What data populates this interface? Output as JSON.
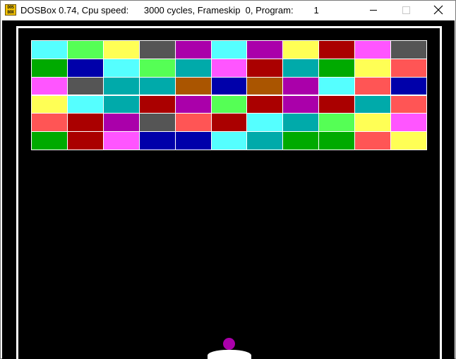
{
  "window": {
    "title": "DOSBox 0.74, Cpu speed:      3000 cycles, Frameskip  0, Program:        1",
    "icon_text": "DOS BOX",
    "icon_name": "dosbox-app-icon",
    "buttons": {
      "minimize": "minimize-icon",
      "maximize": "maximize-icon",
      "close": "close-icon"
    }
  },
  "game": {
    "background": "#000000",
    "wall_color": "#ffffff",
    "paddle_color": "#ffffff",
    "ball_color": "#aa00aa",
    "palette": {
      "LC": "#55ffff",
      "LG": "#55ff55",
      "Y": "#ffff55",
      "DG": "#555555",
      "M": "#aa00aa",
      "R": "#aa0000",
      "LM": "#ff55ff",
      "G": "#00aa00",
      "B": "#0000aa",
      "C": "#00aaaa",
      "LR": "#ff5555",
      "BR": "#aa5500"
    },
    "bricks": [
      [
        "LC",
        "LG",
        "Y",
        "DG",
        "M",
        "LC",
        "M",
        "Y",
        "R",
        "LM",
        "DG"
      ],
      [
        "G",
        "B",
        "LC",
        "LG",
        "C",
        "LM",
        "R",
        "C",
        "G",
        "Y",
        "LR"
      ],
      [
        "LM",
        "DG",
        "C",
        "C",
        "BR",
        "B",
        "BR",
        "M",
        "LC",
        "LR",
        "B"
      ],
      [
        "Y",
        "LC",
        "C",
        "R",
        "M",
        "LG",
        "R",
        "M",
        "R",
        "C",
        "LR"
      ],
      [
        "LR",
        "R",
        "M",
        "DG",
        "LR",
        "R",
        "LC",
        "C",
        "LG",
        "Y",
        "LM"
      ],
      [
        "G",
        "R",
        "LM",
        "B",
        "B",
        "LC",
        "C",
        "G",
        "G",
        "LR",
        "Y"
      ]
    ]
  }
}
